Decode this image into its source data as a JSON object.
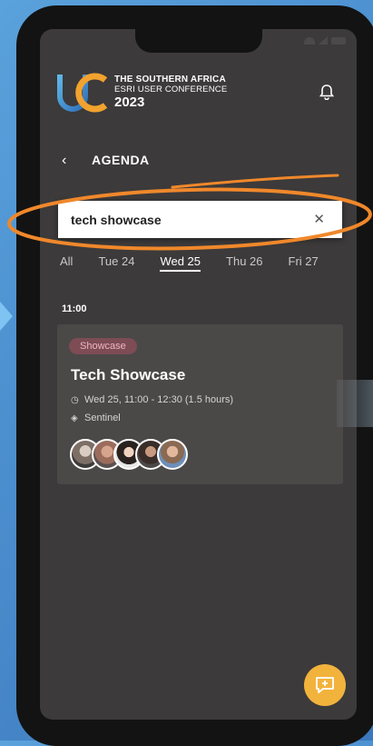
{
  "conference": {
    "line1": "THE SOUTHERN AFRICA",
    "line2": "ESRI USER CONFERENCE",
    "year": "2023"
  },
  "header": {
    "title": "AGENDA"
  },
  "search": {
    "value": "tech showcase",
    "clear_icon": "close-icon"
  },
  "days": [
    {
      "label": "All"
    },
    {
      "label": "Tue 24"
    },
    {
      "label": "Wed 25",
      "active": true
    },
    {
      "label": "Thu 26"
    },
    {
      "label": "Fri 27"
    }
  ],
  "session": {
    "time": "11:00",
    "badge": "Showcase",
    "title": "Tech Showcase",
    "when": "Wed 25, 11:00 - 12:30 (1.5 hours)",
    "location": "Sentinel",
    "speakers_count": 5
  },
  "colors": {
    "accent": "#f2b33d",
    "badge_bg": "#7d4c55",
    "highlight": "#f0882b"
  }
}
